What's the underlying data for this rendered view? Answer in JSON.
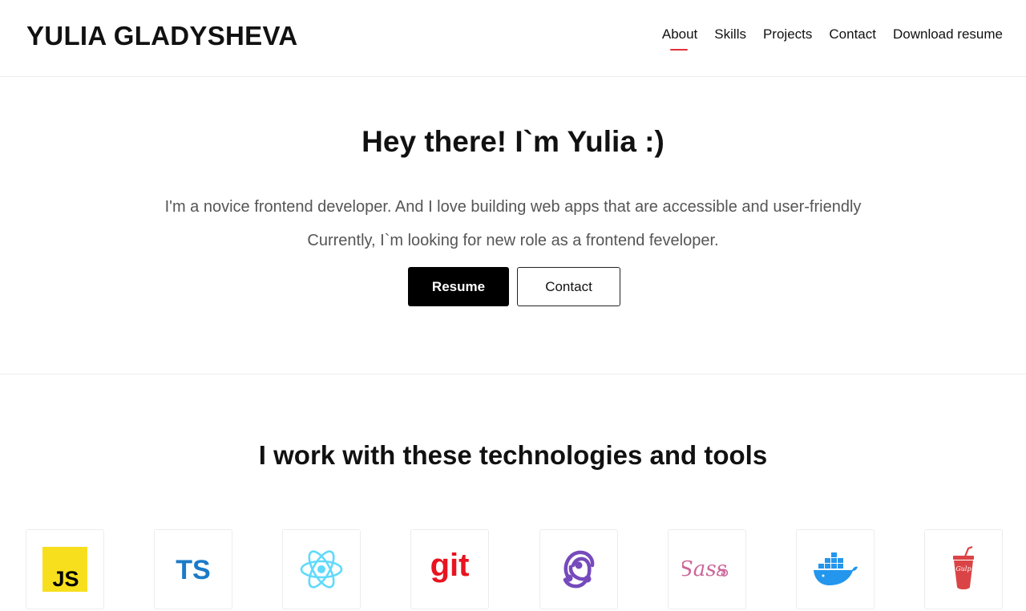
{
  "header": {
    "logo": "YULIA GLADYSHEVA",
    "nav": [
      "About",
      "Skills",
      "Projects",
      "Contact",
      "Download resume"
    ],
    "active_nav": "About",
    "accent_color": "#e1303b"
  },
  "hero": {
    "title": "Hey there! I`m Yulia :)",
    "line1": "I'm a novice frontend developer. And I love building web apps that are accessible and user-friendly",
    "line2": "Currently, I`m looking for new role as a frontend feveloper.",
    "resume_button": "Resume",
    "contact_button": "Contact"
  },
  "skills": {
    "title": "I work with these technologies and tools",
    "tools": [
      {
        "icon": "javascript-icon",
        "label": "JS",
        "color": "#f7df1e"
      },
      {
        "icon": "typescript-icon",
        "label": "TS",
        "color": "#1b7ac8"
      },
      {
        "icon": "react-icon",
        "color": "#61dafb"
      },
      {
        "icon": "git-icon",
        "label": "git",
        "color": "#e8141f"
      },
      {
        "icon": "redux-icon",
        "color": "#764abc"
      },
      {
        "icon": "sass-icon",
        "label": "Sass",
        "color": "#cc6699"
      },
      {
        "icon": "docker-icon",
        "color": "#2496ed"
      },
      {
        "icon": "gulp-icon",
        "label": "Gulp",
        "color": "#db4446"
      }
    ]
  }
}
